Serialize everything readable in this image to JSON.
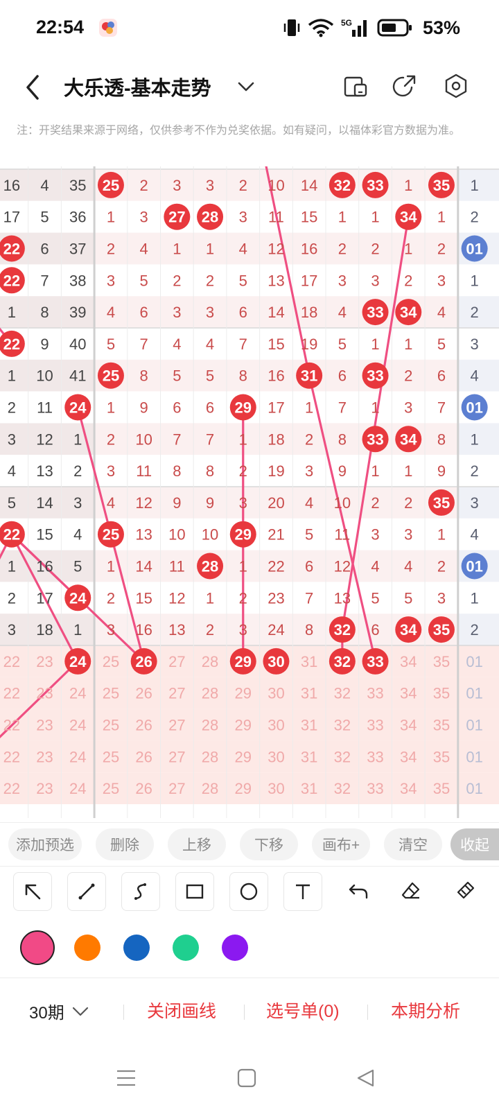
{
  "status_bar": {
    "time": "22:54",
    "network": "5G",
    "battery": "53%",
    "icons": [
      "vibrate-icon",
      "wifi-icon",
      "signal-icon",
      "battery-icon"
    ]
  },
  "header": {
    "title": "大乐透-基本走势",
    "icons": [
      "back-icon",
      "chevron-down-icon",
      "device-icon",
      "share-icon",
      "settings-icon"
    ]
  },
  "notice": "注：开奖结果来源于网络，仅供参考不作为兑奖依据。如有疑问，以福体彩官方数据为准。",
  "grid": {
    "rows": [
      [
        "16",
        "4",
        "35",
        "25",
        "2",
        "3",
        "3",
        "2",
        "10",
        "14",
        "32",
        "33",
        "1",
        "35",
        "1"
      ],
      [
        "17",
        "5",
        "36",
        "1",
        "3",
        "27",
        "28",
        "3",
        "11",
        "15",
        "1",
        "1",
        "34",
        "1",
        "2"
      ],
      [
        "22",
        "6",
        "37",
        "2",
        "4",
        "1",
        "1",
        "4",
        "12",
        "16",
        "2",
        "2",
        "1",
        "2",
        "01"
      ],
      [
        "22",
        "7",
        "38",
        "3",
        "5",
        "2",
        "2",
        "5",
        "13",
        "17",
        "3",
        "3",
        "2",
        "3",
        "1"
      ],
      [
        "1",
        "8",
        "39",
        "4",
        "6",
        "3",
        "3",
        "6",
        "14",
        "18",
        "4",
        "33",
        "34",
        "4",
        "2"
      ],
      [
        "22",
        "9",
        "40",
        "5",
        "7",
        "4",
        "4",
        "7",
        "15",
        "19",
        "5",
        "1",
        "1",
        "5",
        "3"
      ],
      [
        "1",
        "10",
        "41",
        "25",
        "8",
        "5",
        "5",
        "8",
        "16",
        "31",
        "6",
        "33",
        "2",
        "6",
        "4"
      ],
      [
        "2",
        "11",
        "24",
        "1",
        "9",
        "6",
        "6",
        "29",
        "17",
        "1",
        "7",
        "1",
        "3",
        "7",
        "01"
      ],
      [
        "3",
        "12",
        "1",
        "2",
        "10",
        "7",
        "7",
        "1",
        "18",
        "2",
        "8",
        "33",
        "34",
        "8",
        "1"
      ],
      [
        "4",
        "13",
        "2",
        "3",
        "11",
        "8",
        "8",
        "2",
        "19",
        "3",
        "9",
        "1",
        "1",
        "9",
        "2"
      ],
      [
        "5",
        "14",
        "3",
        "4",
        "12",
        "9",
        "9",
        "3",
        "20",
        "4",
        "10",
        "2",
        "2",
        "35",
        "3"
      ],
      [
        "22",
        "15",
        "4",
        "25",
        "13",
        "10",
        "10",
        "29",
        "21",
        "5",
        "11",
        "3",
        "3",
        "1",
        "4"
      ],
      [
        "1",
        "16",
        "5",
        "1",
        "14",
        "11",
        "28",
        "1",
        "22",
        "6",
        "12",
        "4",
        "4",
        "2",
        "01"
      ],
      [
        "2",
        "17",
        "24",
        "2",
        "15",
        "12",
        "1",
        "2",
        "23",
        "7",
        "13",
        "5",
        "5",
        "3",
        "1"
      ],
      [
        "3",
        "18",
        "1",
        "3",
        "16",
        "13",
        "2",
        "3",
        "24",
        "8",
        "32",
        "6",
        "34",
        "35",
        "2"
      ]
    ],
    "hit_flags": [
      [
        0,
        0,
        0,
        1,
        0,
        0,
        0,
        0,
        0,
        0,
        1,
        1,
        0,
        1,
        0
      ],
      [
        0,
        0,
        0,
        0,
        0,
        1,
        1,
        0,
        0,
        0,
        0,
        0,
        1,
        0,
        0
      ],
      [
        1,
        0,
        0,
        0,
        0,
        0,
        0,
        0,
        0,
        0,
        0,
        0,
        0,
        0,
        2
      ],
      [
        1,
        0,
        0,
        0,
        0,
        0,
        0,
        0,
        0,
        0,
        0,
        0,
        0,
        0,
        0
      ],
      [
        0,
        0,
        0,
        0,
        0,
        0,
        0,
        0,
        0,
        0,
        0,
        1,
        1,
        0,
        0
      ],
      [
        1,
        0,
        0,
        0,
        0,
        0,
        0,
        0,
        0,
        0,
        0,
        0,
        0,
        0,
        0
      ],
      [
        0,
        0,
        0,
        1,
        0,
        0,
        0,
        0,
        0,
        1,
        0,
        1,
        0,
        0,
        0
      ],
      [
        0,
        0,
        1,
        0,
        0,
        0,
        0,
        1,
        0,
        0,
        0,
        0,
        0,
        0,
        2
      ],
      [
        0,
        0,
        0,
        0,
        0,
        0,
        0,
        0,
        0,
        0,
        0,
        1,
        1,
        0,
        0
      ],
      [
        0,
        0,
        0,
        0,
        0,
        0,
        0,
        0,
        0,
        0,
        0,
        0,
        0,
        0,
        0
      ],
      [
        0,
        0,
        0,
        0,
        0,
        0,
        0,
        0,
        0,
        0,
        0,
        0,
        0,
        1,
        0
      ],
      [
        1,
        0,
        0,
        1,
        0,
        0,
        0,
        1,
        0,
        0,
        0,
        0,
        0,
        0,
        0
      ],
      [
        0,
        0,
        0,
        0,
        0,
        0,
        1,
        0,
        0,
        0,
        0,
        0,
        0,
        0,
        2
      ],
      [
        0,
        0,
        1,
        0,
        0,
        0,
        0,
        0,
        0,
        0,
        0,
        0,
        0,
        0,
        0
      ],
      [
        0,
        0,
        0,
        0,
        0,
        0,
        0,
        0,
        0,
        0,
        1,
        0,
        1,
        1,
        0
      ]
    ],
    "pick_rows": [
      [
        "22",
        "23",
        "24",
        "25",
        "26",
        "27",
        "28",
        "29",
        "30",
        "31",
        "32",
        "33",
        "34",
        "35",
        "01"
      ],
      [
        "22",
        "23",
        "24",
        "25",
        "26",
        "27",
        "28",
        "29",
        "30",
        "31",
        "32",
        "33",
        "34",
        "35",
        "01"
      ],
      [
        "22",
        "23",
        "24",
        "25",
        "26",
        "27",
        "28",
        "29",
        "30",
        "31",
        "32",
        "33",
        "34",
        "35",
        "01"
      ],
      [
        "22",
        "23",
        "24",
        "25",
        "26",
        "27",
        "28",
        "29",
        "30",
        "31",
        "32",
        "33",
        "34",
        "35",
        "01"
      ],
      [
        "22",
        "23",
        "24",
        "25",
        "26",
        "27",
        "28",
        "29",
        "30",
        "31",
        "32",
        "33",
        "34",
        "35",
        "01"
      ]
    ],
    "selected_picks": [
      "24",
      "26",
      "29",
      "30",
      "32",
      "33"
    ],
    "line_color": "#ef4f82",
    "ball_red": "#e8383d",
    "ball_blue": "#5c7fd1"
  },
  "toolbar": {
    "add_preselect": "添加预选",
    "delete": "删除",
    "move_up": "上移",
    "move_down": "下移",
    "canvas_plus": "画布+",
    "clear": "清空",
    "collapse": "收起"
  },
  "tools": [
    "pointer-arrow-icon",
    "line-tool-icon",
    "curve-tool-icon",
    "rectangle-tool-icon",
    "circle-tool-icon",
    "text-tool-icon",
    "undo-icon",
    "eraser-icon",
    "clear-brush-icon"
  ],
  "colors": {
    "selected": "#f14a86",
    "palette": [
      "#f14a86",
      "#ff7a00",
      "#1565c0",
      "#1fcf8f",
      "#8b19f0"
    ]
  },
  "bottom": {
    "period": "30期",
    "close_lines": "关闭画线",
    "pick_list": "选号单(0)",
    "analysis": "本期分析"
  }
}
